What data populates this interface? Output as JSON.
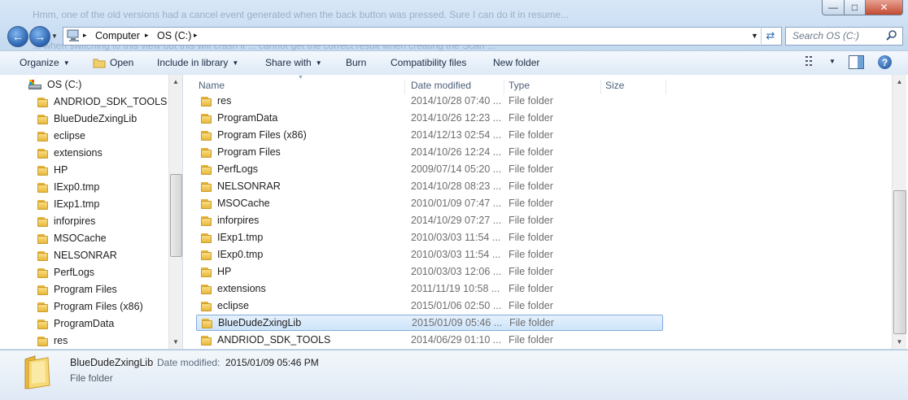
{
  "window": {
    "background_text_top": "Hmm, one of the old versions had a cancel event generated when the back button was pressed. Sure I can do it in resume...",
    "background_text_mid": "... when switching to this view but this will crash it ... cannot get the correct result when creating the Scan ... ",
    "minimize": "—",
    "maximize": "□",
    "close": "✕"
  },
  "address": {
    "crumbs": [
      "Computer",
      "OS (C:)"
    ],
    "separator": "▸"
  },
  "search": {
    "placeholder": "Search OS (C:)"
  },
  "toolbar": {
    "organize": "Organize",
    "open": "Open",
    "include_in_library": "Include in library",
    "share_with": "Share with",
    "burn": "Burn",
    "compatibility_files": "Compatibility files",
    "new_folder": "New folder"
  },
  "nav": {
    "root": "OS (C:)",
    "items": [
      "ANDRIOD_SDK_TOOLS",
      "BlueDudeZxingLib",
      "eclipse",
      "extensions",
      "HP",
      "IExp0.tmp",
      "IExp1.tmp",
      "inforpires",
      "MSOCache",
      "NELSONRAR",
      "PerfLogs",
      "Program Files",
      "Program Files (x86)",
      "ProgramData",
      "res"
    ]
  },
  "columns": {
    "name": "Name",
    "date": "Date modified",
    "type": "Type",
    "size": "Size"
  },
  "files": [
    {
      "name": "res",
      "date": "2014/10/28 07:40 ...",
      "type": "File folder"
    },
    {
      "name": "ProgramData",
      "date": "2014/10/26 12:23 ...",
      "type": "File folder"
    },
    {
      "name": "Program Files (x86)",
      "date": "2014/12/13 02:54 ...",
      "type": "File folder"
    },
    {
      "name": "Program Files",
      "date": "2014/10/26 12:24 ...",
      "type": "File folder"
    },
    {
      "name": "PerfLogs",
      "date": "2009/07/14 05:20 ...",
      "type": "File folder"
    },
    {
      "name": "NELSONRAR",
      "date": "2014/10/28 08:23 ...",
      "type": "File folder"
    },
    {
      "name": "MSOCache",
      "date": "2010/01/09 07:47 ...",
      "type": "File folder"
    },
    {
      "name": "inforpires",
      "date": "2014/10/29 07:27 ...",
      "type": "File folder"
    },
    {
      "name": "IExp1.tmp",
      "date": "2010/03/03 11:54 ...",
      "type": "File folder"
    },
    {
      "name": "IExp0.tmp",
      "date": "2010/03/03 11:54 ...",
      "type": "File folder"
    },
    {
      "name": "HP",
      "date": "2010/03/03 12:06 ...",
      "type": "File folder"
    },
    {
      "name": "extensions",
      "date": "2011/11/19 10:58 ...",
      "type": "File folder"
    },
    {
      "name": "eclipse",
      "date": "2015/01/06 02:50 ...",
      "type": "File folder"
    },
    {
      "name": "BlueDudeZxingLib",
      "date": "2015/01/09 05:46 ...",
      "type": "File folder",
      "selected": true
    },
    {
      "name": "ANDRIOD_SDK_TOOLS",
      "date": "2014/06/29 01:10 ...",
      "type": "File folder"
    }
  ],
  "details": {
    "name": "BlueDudeZxingLib",
    "date_label": "Date modified:",
    "date": "2015/01/09 05:46 PM",
    "type": "File folder"
  }
}
